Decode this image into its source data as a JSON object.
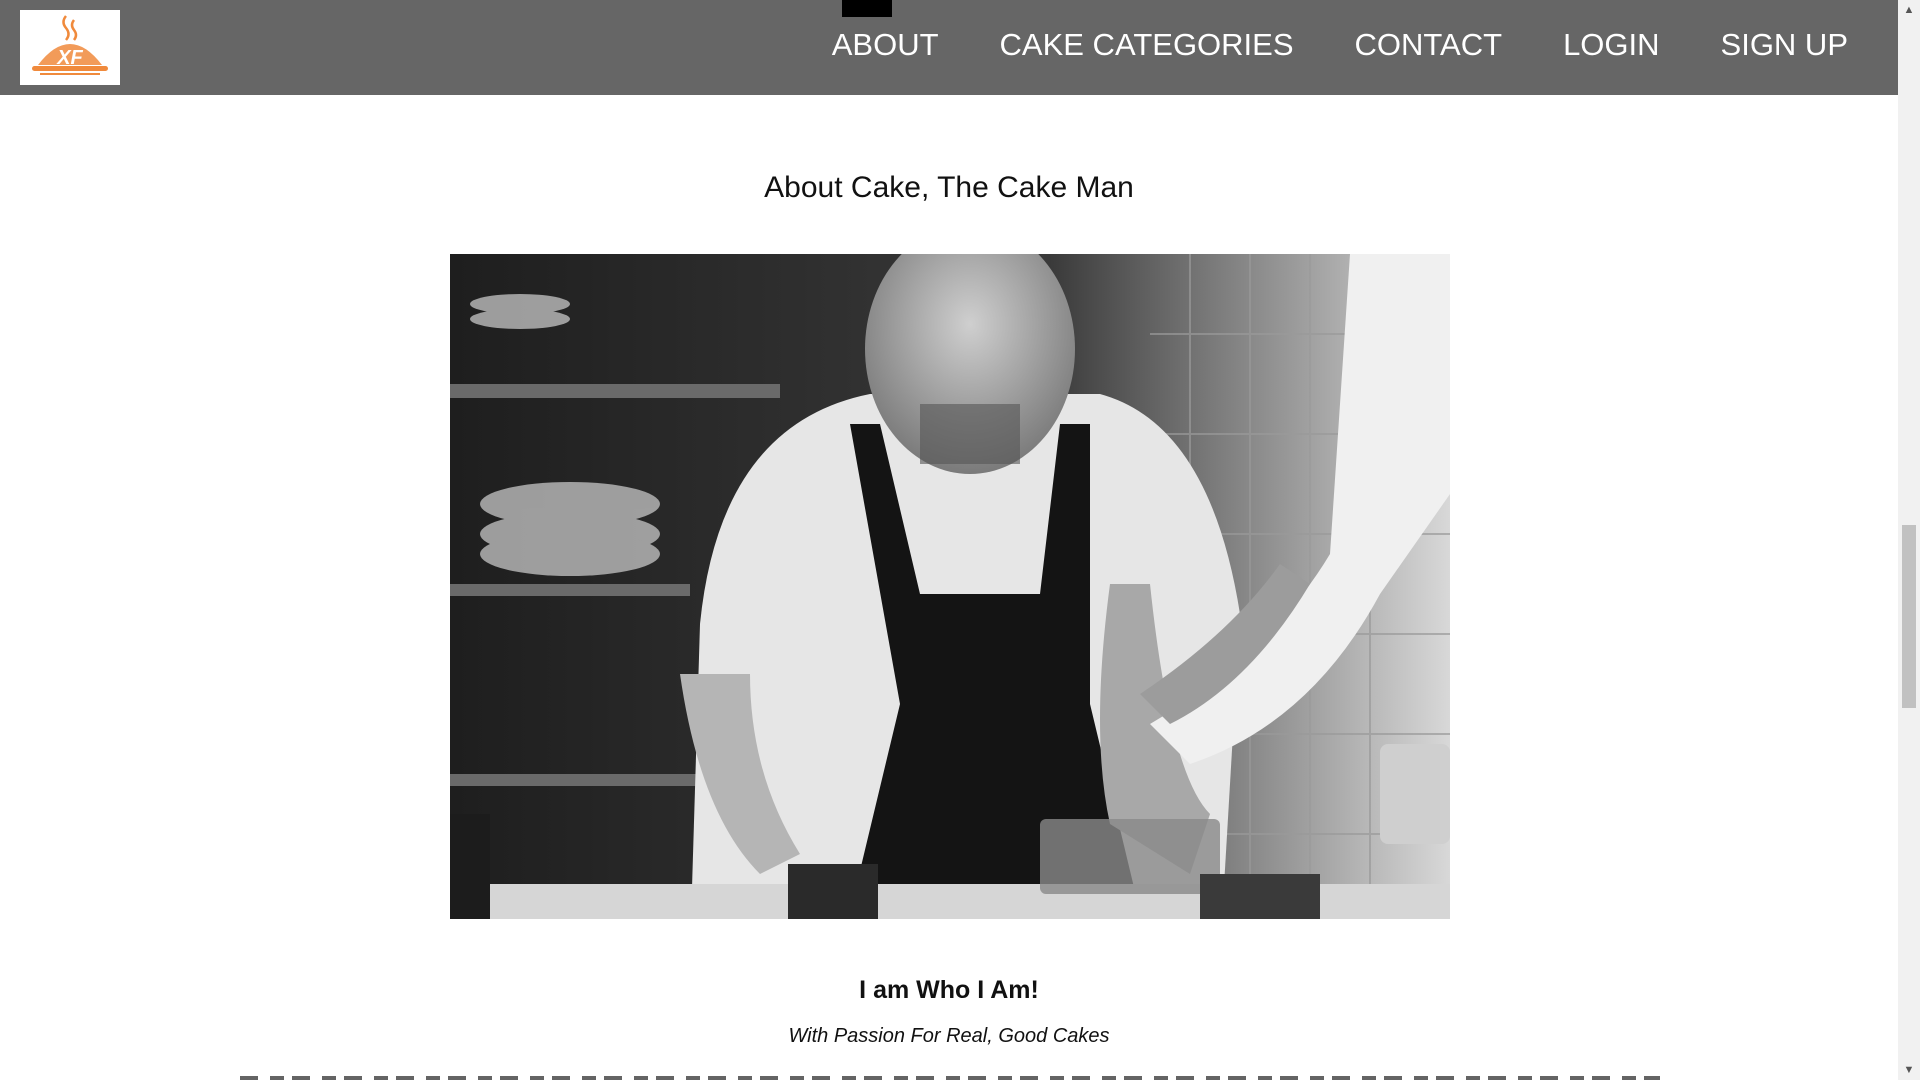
{
  "header": {
    "logo_text": "XF",
    "nav": [
      {
        "label": "ABOUT",
        "active": true
      },
      {
        "label": "CAKE CATEGORIES"
      },
      {
        "label": "CONTACT"
      },
      {
        "label": "LOGIN"
      },
      {
        "label": "SIGN UP"
      }
    ]
  },
  "main": {
    "title": "About Cake, The Cake Man",
    "image_icon": "chef-photo",
    "heading": "I am Who I Am!",
    "tagline": "With Passion For Real, Good Cakes"
  },
  "colors": {
    "header_bg": "#666666",
    "logo_accent": "#f08a3c",
    "active_marker": "#000000"
  }
}
